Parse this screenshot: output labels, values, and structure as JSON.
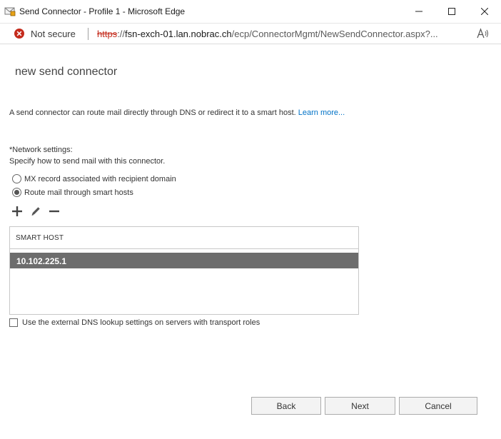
{
  "window": {
    "title": "Send Connector - Profile 1 - Microsoft Edge",
    "icons": [
      "envelope-app-icon",
      "minimize-icon",
      "maximize-icon",
      "close-icon"
    ]
  },
  "address_bar": {
    "security_label": "Not secure",
    "url_scheme": "https",
    "url_host": "fsn-exch-01.lan.nobrac.ch",
    "url_path": "/ecp/ConnectorMgmt/NewSendConnector.aspx?...",
    "read_aloud_glyph": "A))",
    "security_color": "#c42b1c"
  },
  "page": {
    "title": "new send connector",
    "intro_text": "A send connector can route mail directly through DNS or redirect it to a smart host. ",
    "learn_more": "Learn more...",
    "network_label": "*Network settings:",
    "network_sub": "Specify how to send mail with this connector.",
    "routing_options": [
      {
        "label": "MX record associated with recipient domain",
        "selected": false
      },
      {
        "label": "Route mail through smart hosts",
        "selected": true
      }
    ],
    "toolbar_icons": [
      "add-icon",
      "edit-icon",
      "remove-icon"
    ],
    "smart_host_table": {
      "header": "SMART HOST",
      "rows": [
        "10.102.225.1"
      ],
      "selected_row_color": "#6d6d6d"
    },
    "dns_checkbox_label": "Use the external DNS lookup settings on servers with transport roles",
    "dns_checkbox_checked": false
  },
  "footer": {
    "back_label": "Back",
    "next_label": "Next",
    "cancel_label": "Cancel"
  }
}
